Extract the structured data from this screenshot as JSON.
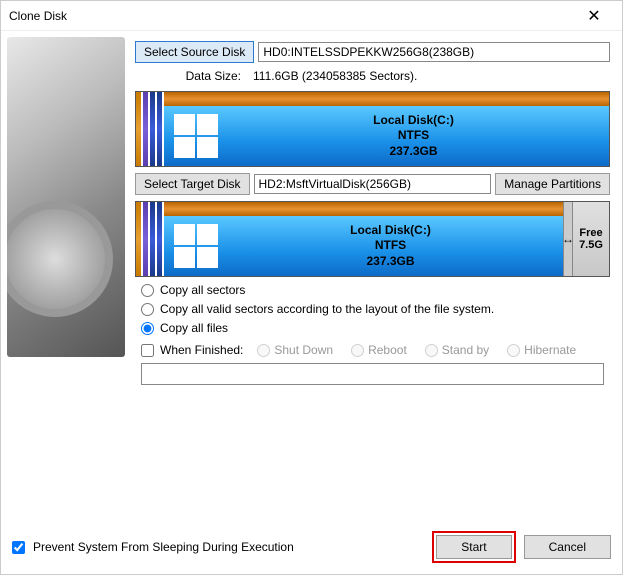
{
  "titlebar": {
    "title": "Clone Disk"
  },
  "source": {
    "button": "Select Source Disk",
    "value": "HD0:INTELSSDPEKKW256G8(238GB)",
    "datasize_label": "Data Size:",
    "datasize_value": "111.6GB (234058385 Sectors)."
  },
  "target": {
    "button": "Select Target Disk",
    "value": "HD2:MsftVirtualDisk(256GB)",
    "manage": "Manage Partitions"
  },
  "partition": {
    "name": "Local Disk(C:)",
    "fs": "NTFS",
    "size": "237.3GB"
  },
  "free": {
    "label": "Free",
    "size": "7.5G"
  },
  "copy": {
    "opt1": "Copy all sectors",
    "opt2": "Copy all valid sectors according to the layout of the file system.",
    "opt3": "Copy all files"
  },
  "finish": {
    "checkbox": "When Finished:",
    "shutdown": "Shut Down",
    "reboot": "Reboot",
    "standby": "Stand by",
    "hibernate": "Hibernate"
  },
  "footer": {
    "prevent": "Prevent System From Sleeping During Execution",
    "start": "Start",
    "cancel": "Cancel"
  }
}
